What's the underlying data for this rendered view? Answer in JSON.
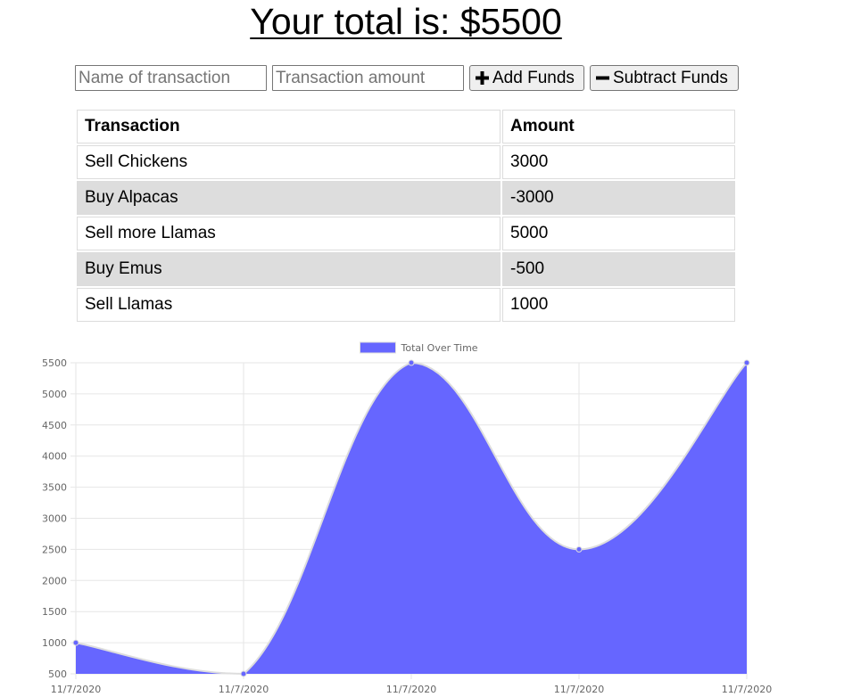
{
  "header": {
    "title": "Your total is: $5500"
  },
  "form": {
    "name_placeholder": "Name of transaction",
    "amount_placeholder": "Transaction amount",
    "add_label": "Add Funds",
    "subtract_label": "Subtract Funds",
    "add_icon": "plus-icon",
    "subtract_icon": "minus-icon"
  },
  "table": {
    "headers": [
      "Transaction",
      "Amount"
    ],
    "rows": [
      {
        "name": "Sell Chickens",
        "amount": "3000"
      },
      {
        "name": "Buy Alpacas",
        "amount": "-3000"
      },
      {
        "name": "Sell more Llamas",
        "amount": "5000"
      },
      {
        "name": "Buy Emus",
        "amount": "-500"
      },
      {
        "name": "Sell Llamas",
        "amount": "1000"
      }
    ]
  },
  "colors": {
    "series_fill": "#6666ff",
    "series_line": "#dddddd",
    "grid": "#e6e6e6",
    "shaded_row": "#dddddd"
  },
  "chart_data": {
    "type": "area",
    "x": [
      "11/7/2020",
      "11/7/2020",
      "11/7/2020",
      "11/7/2020",
      "11/7/2020"
    ],
    "series": [
      {
        "name": "Total Over Time",
        "values": [
          1000,
          500,
          5500,
          2500,
          5500
        ]
      }
    ],
    "ylim": [
      500,
      5500
    ],
    "yticks": [
      500,
      1000,
      1500,
      2000,
      2500,
      3000,
      3500,
      4000,
      4500,
      5000,
      5500
    ],
    "grid": true,
    "legend": "top"
  }
}
